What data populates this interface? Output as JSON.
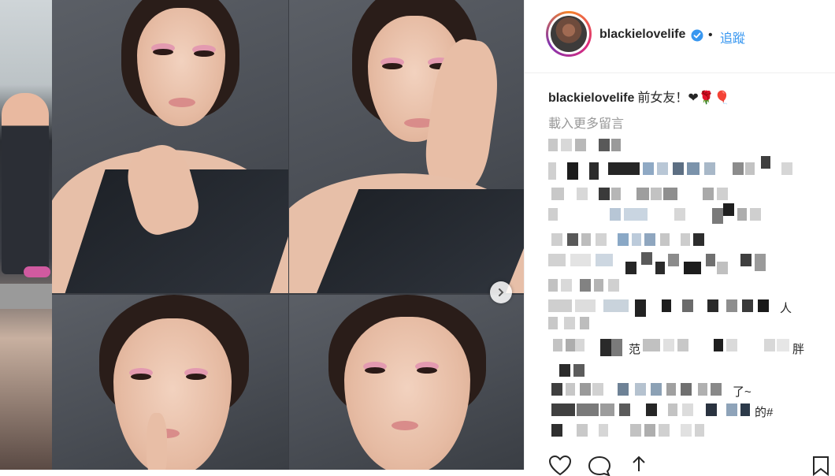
{
  "post": {
    "username": "blackielovelife",
    "separator": "•",
    "follow_label": "追蹤",
    "caption_user": "blackielovelife",
    "caption_text": "前女友！❤🌹🎈",
    "load_more_label": "載入更多留言",
    "comment_fragments": {
      "f1": "范",
      "f2": "胖",
      "f3": "人",
      "f4": "了~",
      "f5": "的#"
    }
  },
  "icons": {
    "verified": "verified-badge-icon",
    "next": "chevron-right-icon",
    "like": "heart-icon",
    "comment": "comment-bubble-icon",
    "share": "share-arrow-icon",
    "save": "bookmark-icon"
  },
  "colors": {
    "link": "#3897f0",
    "text": "#262626",
    "muted": "#999999"
  }
}
